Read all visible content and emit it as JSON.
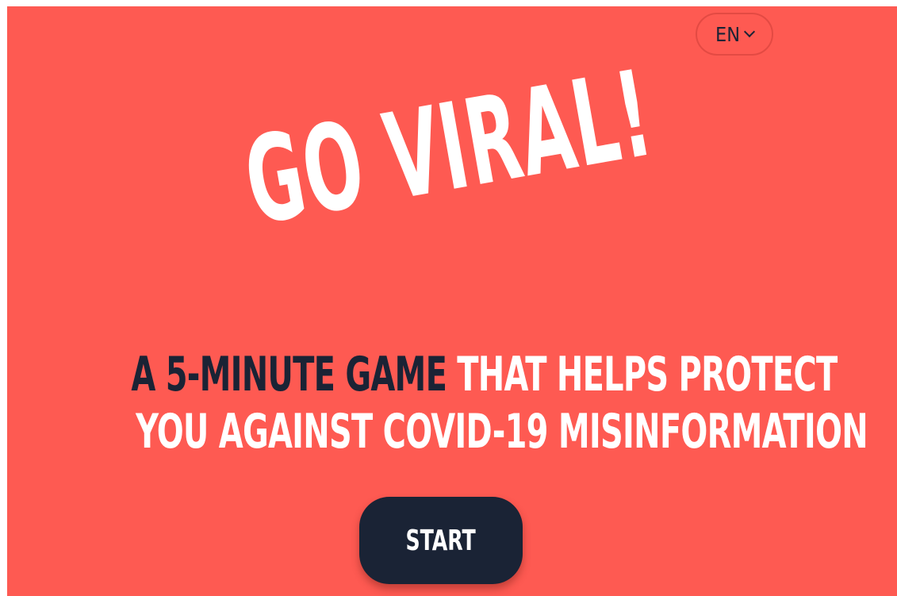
{
  "language_selector": {
    "label": "EN",
    "icon": "chevron-down-icon"
  },
  "logo": {
    "text": "GO VIRAL!"
  },
  "tagline": {
    "highlight": "A 5-MINUTE GAME",
    "rest_line1": "THAT HELPS PROTECT",
    "line2": "YOU AGAINST COVID-19 MISINFORMATION"
  },
  "start_button": {
    "label": "START"
  },
  "colors": {
    "background": "#fe5a52",
    "dark_navy": "#1a2335",
    "white": "#ffffff"
  }
}
